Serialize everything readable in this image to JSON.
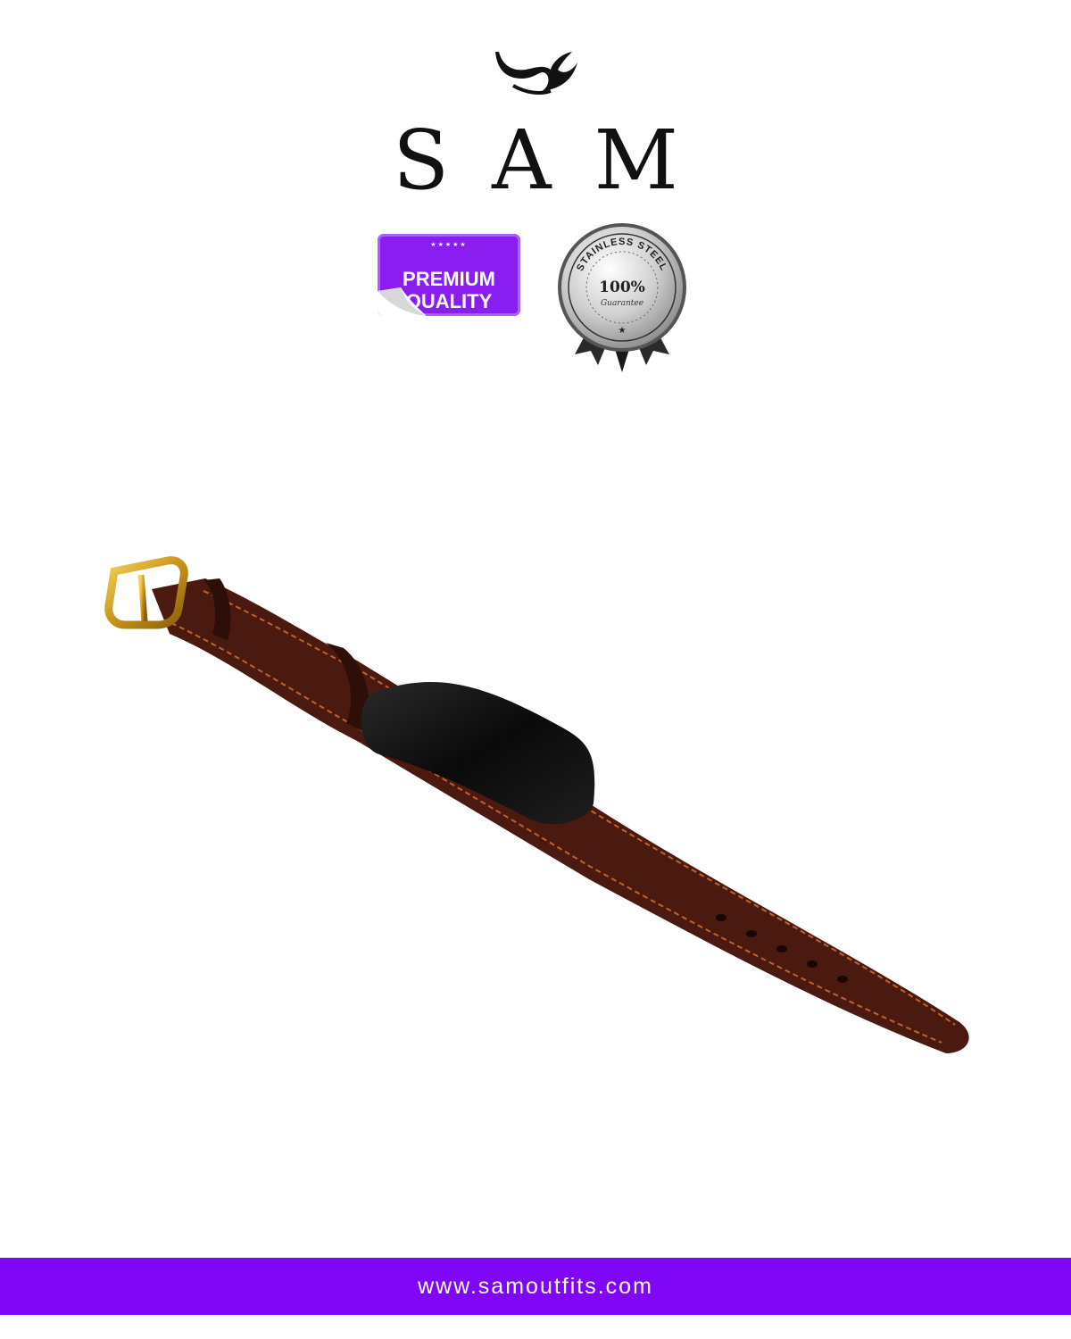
{
  "brand": {
    "name": "SAM"
  },
  "badges": {
    "premium": {
      "line1": "PREMIUM",
      "line2": "QUALITY",
      "stars": "★★★★★"
    },
    "seal": {
      "top_text": "STAINLESS STEEL",
      "percent": "100%",
      "guarantee": "Guarantee"
    }
  },
  "product": {
    "icon": "leather-bracelet-image"
  },
  "footer": {
    "website": "www.samoutfits.com"
  },
  "colors": {
    "accent": "#7f06f7",
    "premium_badge": "#8a1ef0",
    "leather": "#4a1a10",
    "stitch": "#c0622a",
    "buckle": "#d4a020",
    "plate": "#111111"
  }
}
